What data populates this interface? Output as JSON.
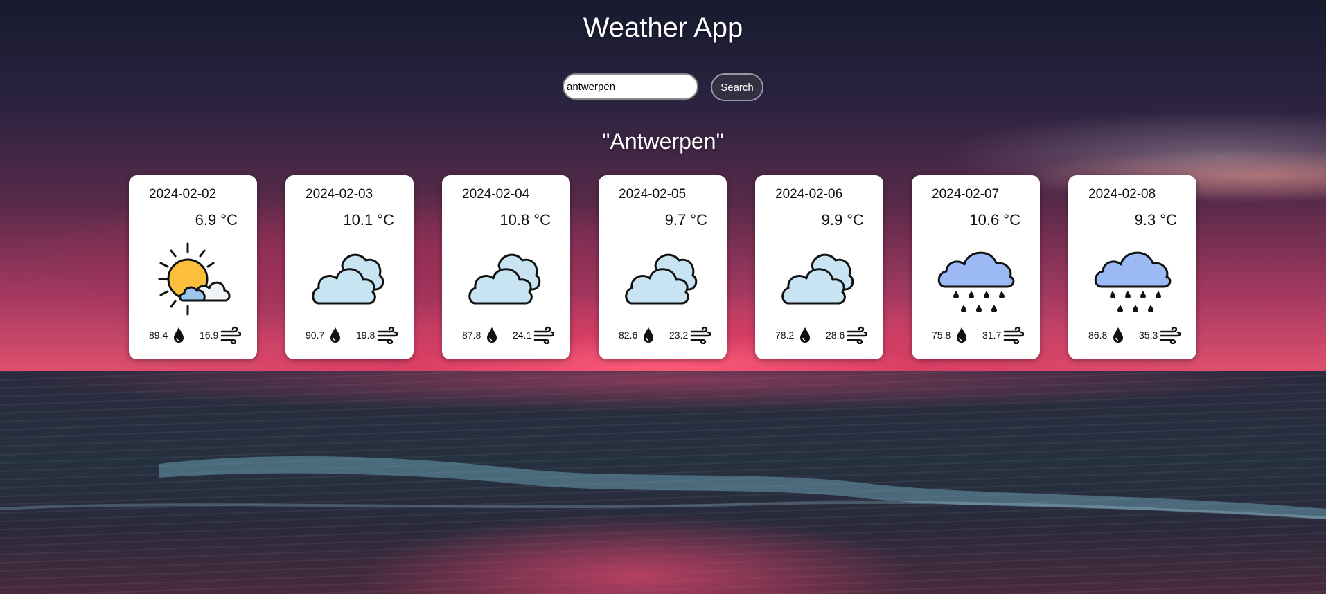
{
  "app": {
    "title": "Weather App"
  },
  "search": {
    "value": "antwerpen",
    "button_label": "Search"
  },
  "city": "\"Antwerpen\"",
  "units": {
    "temperature": "°C"
  },
  "forecast": [
    {
      "date": "2024-02-02",
      "temp": "6.9 °C",
      "icon": "partly-cloudy-sun-icon",
      "humidity": "89.4",
      "wind": "16.9"
    },
    {
      "date": "2024-02-03",
      "temp": "10.1 °C",
      "icon": "cloudy-icon",
      "humidity": "90.7",
      "wind": "19.8"
    },
    {
      "date": "2024-02-04",
      "temp": "10.8 °C",
      "icon": "cloudy-icon",
      "humidity": "87.8",
      "wind": "24.1"
    },
    {
      "date": "2024-02-05",
      "temp": "9.7 °C",
      "icon": "cloudy-icon",
      "humidity": "82.6",
      "wind": "23.2"
    },
    {
      "date": "2024-02-06",
      "temp": "9.9 °C",
      "icon": "cloudy-icon",
      "humidity": "78.2",
      "wind": "28.6"
    },
    {
      "date": "2024-02-07",
      "temp": "10.6 °C",
      "icon": "rain-icon",
      "humidity": "75.8",
      "wind": "31.7"
    },
    {
      "date": "2024-02-08",
      "temp": "9.3 °C",
      "icon": "rain-icon",
      "humidity": "86.8",
      "wind": "35.3"
    }
  ],
  "colors": {
    "card_bg": "#ffffff",
    "sun": "#fbbf3c",
    "cloud_light": "#c8e3f1",
    "cloud_rain": "#9bb9f5",
    "outline": "#111111"
  }
}
